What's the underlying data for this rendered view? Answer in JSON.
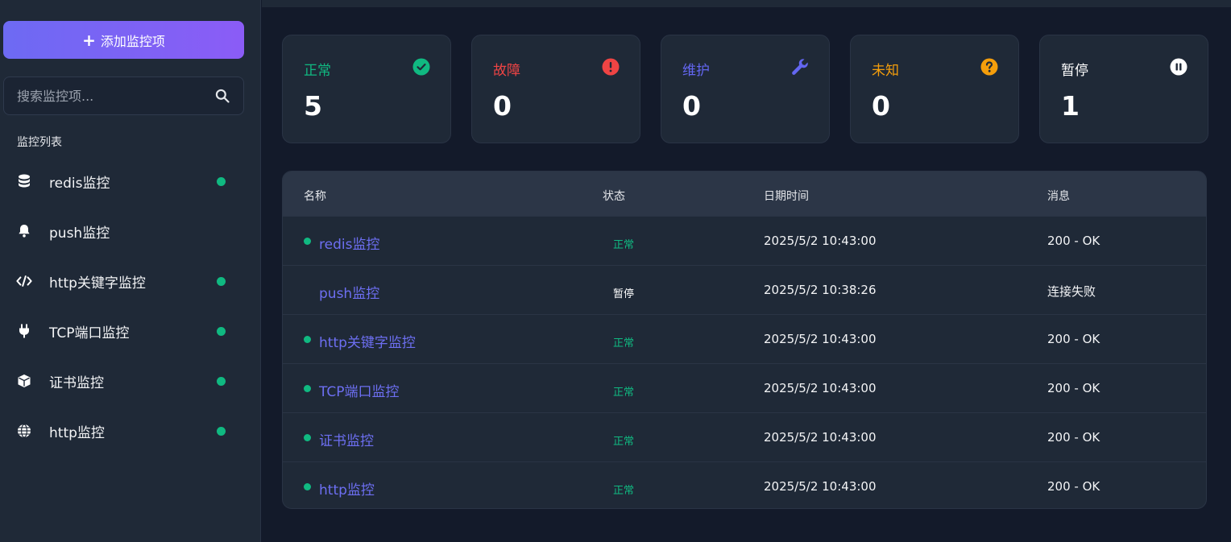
{
  "sidebar": {
    "add_button_label": "添加监控项",
    "search_placeholder": "搜索监控项...",
    "section_title": "监控列表",
    "items": [
      {
        "label": "redis监控",
        "icon": "database-icon",
        "active": true
      },
      {
        "label": "push监控",
        "icon": "bell-icon",
        "active": false
      },
      {
        "label": "http关键字监控",
        "icon": "code-icon",
        "active": true
      },
      {
        "label": "TCP端口监控",
        "icon": "plug-icon",
        "active": true
      },
      {
        "label": "证书监控",
        "icon": "cube-icon",
        "active": true
      },
      {
        "label": "http监控",
        "icon": "globe-icon",
        "active": true
      }
    ]
  },
  "cards": [
    {
      "label": "正常",
      "value": "5",
      "color": "#10b981",
      "icon": "check-circle-icon"
    },
    {
      "label": "故障",
      "value": "0",
      "color": "#ef4444",
      "icon": "alert-circle-icon"
    },
    {
      "label": "维护",
      "value": "0",
      "color": "#6366f1",
      "icon": "wrench-icon"
    },
    {
      "label": "未知",
      "value": "0",
      "color": "#f59e0b",
      "icon": "question-circle-icon"
    },
    {
      "label": "暂停",
      "value": "1",
      "color": "#ffffff",
      "icon": "pause-circle-icon"
    }
  ],
  "table": {
    "headers": {
      "name": "名称",
      "status": "状态",
      "datetime": "日期时间",
      "message": "消息"
    },
    "rows": [
      {
        "name": "redis监控",
        "status": "正常",
        "status_color": "#10b981",
        "datetime": "2025/5/2 10:43:00",
        "message": "200 - OK",
        "dot": true
      },
      {
        "name": "push监控",
        "status": "暂停",
        "status_color": "#ffffff",
        "datetime": "2025/5/2 10:38:26",
        "message": "连接失败",
        "dot": false
      },
      {
        "name": "http关键字监控",
        "status": "正常",
        "status_color": "#10b981",
        "datetime": "2025/5/2 10:43:00",
        "message": "200 - OK",
        "dot": true
      },
      {
        "name": "TCP端口监控",
        "status": "正常",
        "status_color": "#10b981",
        "datetime": "2025/5/2 10:43:00",
        "message": "200 - OK",
        "dot": true
      },
      {
        "name": "证书监控",
        "status": "正常",
        "status_color": "#10b981",
        "datetime": "2025/5/2 10:43:00",
        "message": "200 - OK",
        "dot": true
      },
      {
        "name": "http监控",
        "status": "正常",
        "status_color": "#10b981",
        "datetime": "2025/5/2 10:43:00",
        "message": "200 - OK",
        "dot": true
      }
    ]
  }
}
